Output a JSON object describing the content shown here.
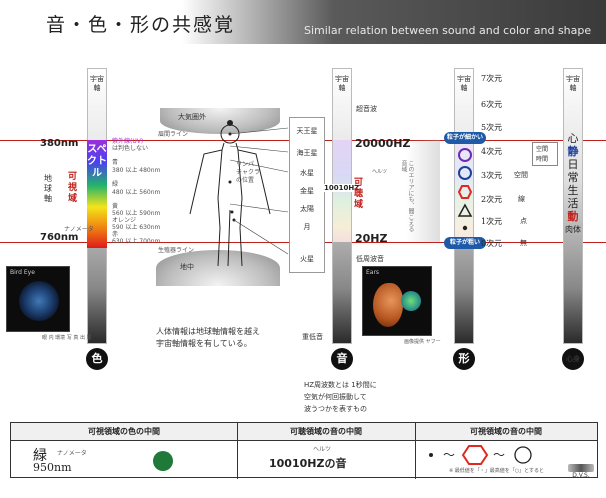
{
  "header": {
    "title": "音・色・形の共感覚",
    "subtitle": "Similar relation between sound and color and shape"
  },
  "axis_label": "宇宙軸",
  "color_col": {
    "badge": "色",
    "top_nm": "380nm",
    "bottom_nm": "760nm",
    "range_label": "可視域",
    "spectrum_label": "スペクトル",
    "earth_axis": "地球軸",
    "ruby_nm": "ナノメータ",
    "colors": [
      "紫外線(UV)",
      "は判色しない",
      "青",
      "380 以上 480nm",
      "緑",
      "480 以上 560nm",
      "黄",
      "560 以上 590nm",
      "オレンジ",
      "590 以上 630nm",
      "赤",
      "630 以上 700nm"
    ],
    "photo_caption": "眼 内 環境 写 真 出 展",
    "photo_label": "Bird Eye"
  },
  "body": {
    "top_label": "大気圏外",
    "top_line": "眉間ライン",
    "bottom_line": "生殖器ライン",
    "ground": "地中",
    "chakra": [
      "リンパ",
      "チャクラ",
      "の位置"
    ],
    "caption": [
      "人体情報は地球軸情報を越え",
      "宇宙軸情報を有している。"
    ],
    "planets": [
      "天王星",
      "海王星",
      "水星",
      "金星",
      "太陽",
      "月",
      "火星"
    ]
  },
  "sound_col": {
    "badge": "音",
    "ultra": "超音波",
    "low": "低周波音",
    "heavy": "重低音",
    "top_hz": "20000HZ",
    "mid_hz": "10010HZ",
    "bottom_hz": "20HZ",
    "range_label": "可聴域",
    "ruby_hz": "ヘルツ",
    "vertical": "このエリアにも、聞こえる音域",
    "photo_caption": "画像提供 ヤフー",
    "photo_label": "Ears",
    "note": [
      "HZ周波数とは 1秒間に",
      "空気が何回振動して",
      "波うつかを表すもの"
    ]
  },
  "shape_col": {
    "badge": "形",
    "particle_small": "粒子が細かい",
    "particle_large": "粒子が粗い",
    "shape_names": [
      "circle",
      "circle",
      "hexagon",
      "triangle",
      "dot"
    ]
  },
  "dims": [
    {
      "n": "7次元",
      "extra": ""
    },
    {
      "n": "6次元",
      "extra": ""
    },
    {
      "n": "5次元",
      "extra": ""
    },
    {
      "n": "4次元",
      "extra": "時間"
    },
    {
      "n": "3次元",
      "extra": "空間"
    },
    {
      "n": "2次元",
      "extra": "線"
    },
    {
      "n": "1次元",
      "extra": "点"
    },
    {
      "n": "0次元",
      "extra": "無"
    }
  ],
  "time_space_box": [
    "空間",
    "時間"
  ],
  "heart_col": {
    "badge": "心身",
    "words": [
      "心",
      "静",
      "日",
      "常",
      "生",
      "活",
      "動",
      "肉体"
    ]
  },
  "bottom": {
    "h1": "可視領域の色の中間",
    "h2": "可聴領域の音の中間",
    "h3": "可視領域の音の中間",
    "color_name": "緑",
    "nm_value": "950nm",
    "ruby_nm": "ナノメータ",
    "hz_ruby": "ヘルツ",
    "hz_value": "10010HZの音",
    "shape_seq": "・〜 〜",
    "note": "※ 最低値を「・」最高値を「○」とすると",
    "green": "#1f7a3a"
  },
  "logo": "D.V.S."
}
